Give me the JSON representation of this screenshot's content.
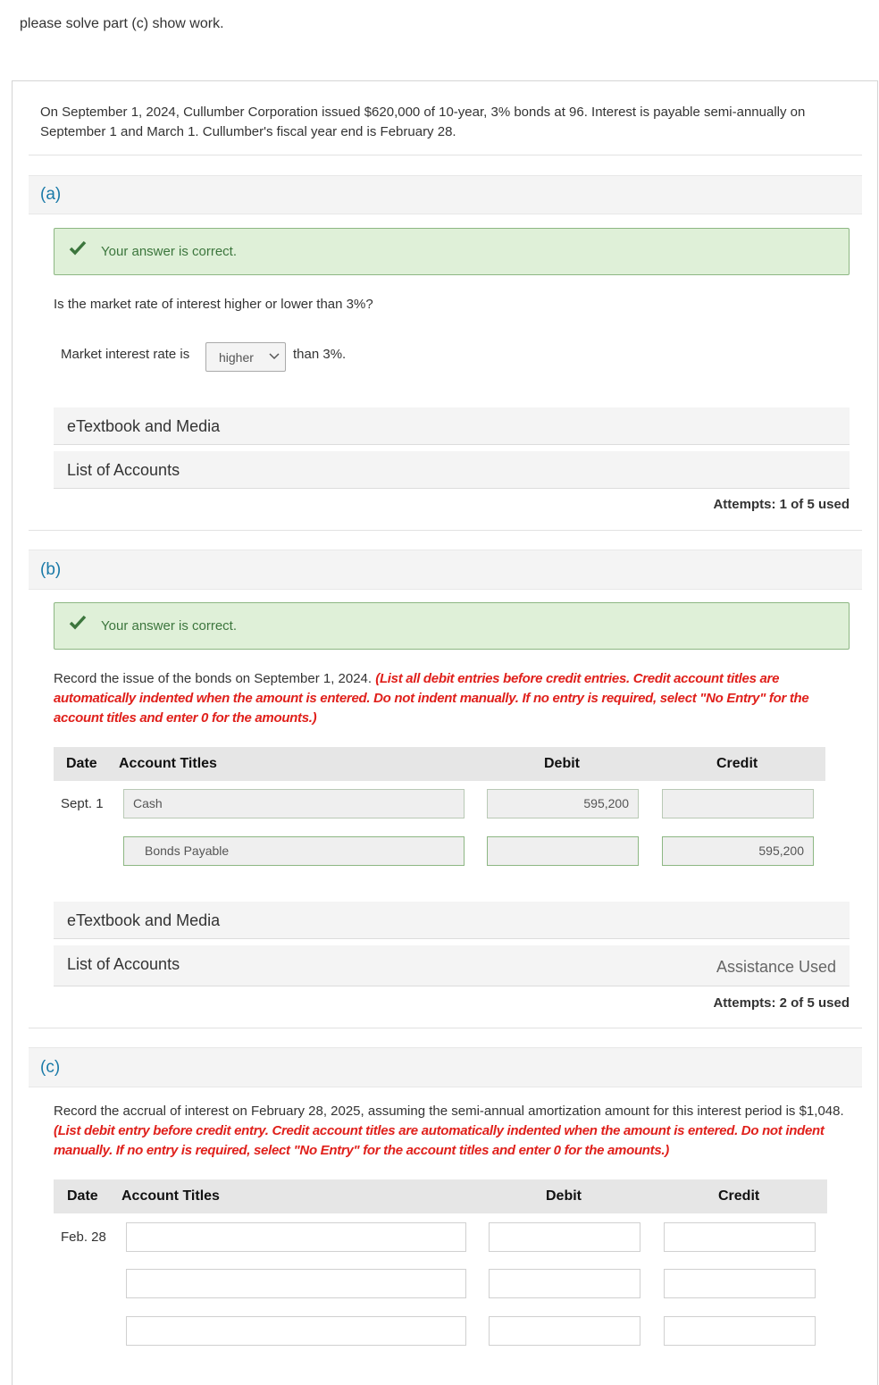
{
  "question": "please solve part (c) show work.",
  "problem": "On September 1, 2024, Cullumber Corporation issued $620,000 of 10-year, 3% bonds at 96. Interest is payable semi-annually on September 1 and March 1. Cullumber's fiscal year end is February 28.",
  "colors": {
    "accent": "#1a7aa8",
    "correct_bg": "#dff0d8",
    "correct_text": "#3c763d",
    "instruction_red": "#e0201b"
  },
  "part_a": {
    "label": "(a)",
    "feedback": "Your answer is correct.",
    "feedback_icon": "check-icon",
    "prompt": "Is the market rate of interest higher or lower than 3%?",
    "sentence_pre": "Market interest rate is",
    "select_value": "higher",
    "sentence_post": "than 3%.",
    "etextbook": "eTextbook and Media",
    "list_accounts": "List of Accounts",
    "attempts": "Attempts: 1 of 5 used"
  },
  "part_b": {
    "label": "(b)",
    "feedback": "Your answer is correct.",
    "prompt": "Record the issue of the bonds on September 1, 2024.",
    "instruction": "(List all debit entries before credit entries. Credit account titles are automatically indented when the amount is entered. Do not indent manually. If no entry is required, select \"No Entry\" for the account titles and enter 0 for the amounts.)",
    "headers": {
      "date": "Date",
      "account": "Account Titles",
      "debit": "Debit",
      "credit": "Credit"
    },
    "rows": [
      {
        "date": "Sept. 1",
        "account": "Cash",
        "debit": "595,200",
        "credit": ""
      },
      {
        "date": "",
        "account": "Bonds Payable",
        "debit": "",
        "credit": "595,200"
      }
    ],
    "etextbook": "eTextbook and Media",
    "list_accounts": "List of Accounts",
    "assistance": "Assistance Used",
    "attempts": "Attempts: 2 of 5 used"
  },
  "part_c": {
    "label": "(c)",
    "prompt": "Record the accrual of interest on February 28, 2025, assuming the semi-annual amortization amount for this interest period is $1,048.",
    "instruction": "(List debit entry before credit entry. Credit account titles are automatically indented when the amount is entered. Do not indent manually. If no entry is required, select \"No Entry\" for the account titles and enter 0 for the amounts.)",
    "headers": {
      "date": "Date",
      "account": "Account Titles",
      "debit": "Debit",
      "credit": "Credit"
    },
    "rows": [
      {
        "date": "Feb. 28",
        "account": "",
        "debit": "",
        "credit": ""
      },
      {
        "date": "",
        "account": "",
        "debit": "",
        "credit": ""
      },
      {
        "date": "",
        "account": "",
        "debit": "",
        "credit": ""
      }
    ]
  }
}
